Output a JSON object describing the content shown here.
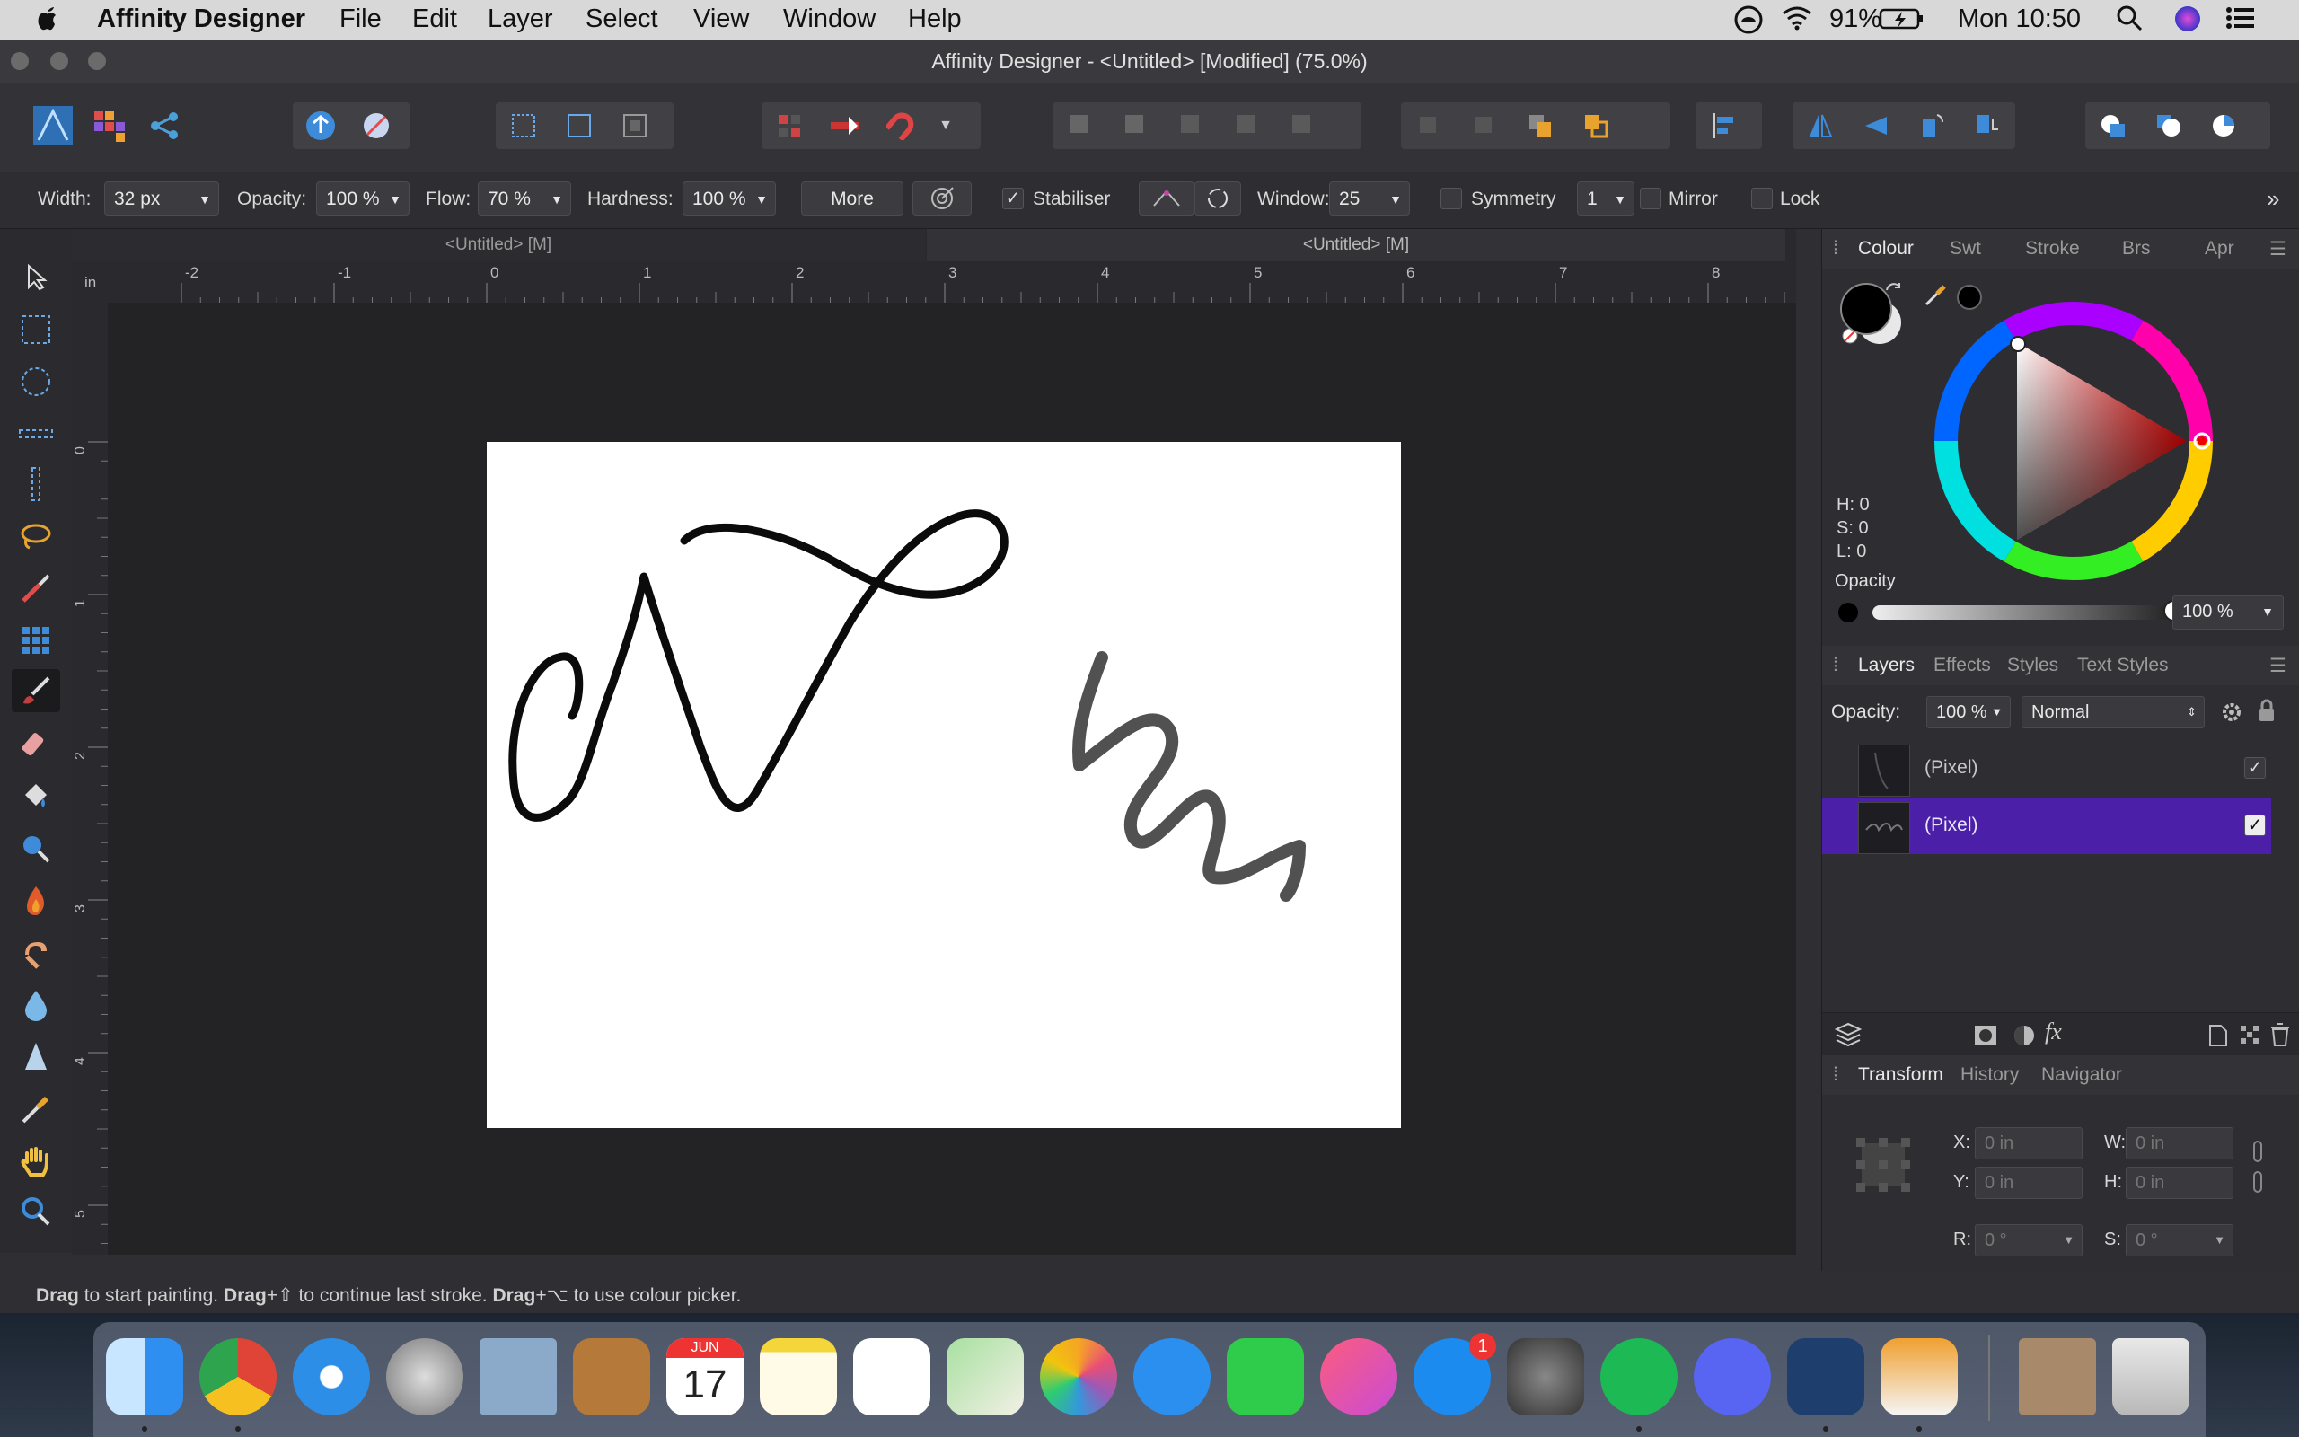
{
  "menubar": {
    "apple": "",
    "app_name": "Affinity Designer",
    "items": [
      "File",
      "Edit",
      "Layer",
      "Select",
      "View",
      "Window",
      "Help"
    ],
    "battery": "91%",
    "clock": "Mon 10:50"
  },
  "window": {
    "title": "Affinity Designer - <Untitled> [Modified] (75.0%)"
  },
  "context_toolbar": {
    "width_label": "Width:",
    "width_value": "32 px",
    "opacity_label": "Opacity:",
    "opacity_value": "100 %",
    "flow_label": "Flow:",
    "flow_value": "70 %",
    "hardness_label": "Hardness:",
    "hardness_value": "100 %",
    "more_label": "More",
    "stabiliser_label": "Stabiliser",
    "stabiliser_checked": true,
    "window_label": "Window:",
    "window_value": "25",
    "symmetry_label": "Symmetry",
    "symmetry_value": "1",
    "mirror_label": "Mirror",
    "lock_label": "Lock"
  },
  "doc_tabs": [
    "<Untitled> [M]",
    "<Untitled> [M]"
  ],
  "ruler": {
    "unit": "in",
    "top_ticks": [
      "-2",
      "-1",
      "0",
      "1",
      "2",
      "3",
      "4",
      "5",
      "6",
      "7",
      "8"
    ],
    "left_ticks": [
      "0",
      "1",
      "2",
      "3",
      "4",
      "5"
    ]
  },
  "status_bar": {
    "b1": "Drag",
    "t1": " to start painting. ",
    "b2": "Drag",
    "t2": "+⇧ to continue last stroke. ",
    "b3": "Drag",
    "t3": "+⌥ to use colour picker."
  },
  "colour_panel": {
    "tabs": [
      "Colour",
      "Swt",
      "Stroke",
      "Brs",
      "Apr"
    ],
    "h": "H: 0",
    "s": "S: 0",
    "l": "L: 0",
    "opacity_label": "Opacity",
    "opacity_value": "100 %"
  },
  "layers_panel": {
    "tabs": [
      "Layers",
      "Effects",
      "Styles",
      "Text Styles"
    ],
    "opacity_label": "Opacity:",
    "opacity_value": "100 %",
    "blend_mode": "Normal",
    "layers": [
      {
        "name": "(Pixel)",
        "visible": true,
        "selected": false
      },
      {
        "name": "(Pixel)",
        "visible": true,
        "selected": true
      }
    ]
  },
  "transform_panel": {
    "tabs": [
      "Transform",
      "History",
      "Navigator"
    ],
    "x_label": "X:",
    "x_placeholder": "0 in",
    "y_label": "Y:",
    "y_placeholder": "0 in",
    "w_label": "W:",
    "w_placeholder": "0 in",
    "h_label": "H:",
    "h_placeholder": "0 in",
    "r_label": "R:",
    "r_value": "0 °",
    "s_label": "S:",
    "s_value": "0 °"
  },
  "dock": {
    "calendar_month": "JUN",
    "calendar_day": "17",
    "appstore_badge": "1"
  },
  "colors": {
    "selected_layer": "#4b1fa8",
    "accent_blue": "#3d8bd9"
  }
}
